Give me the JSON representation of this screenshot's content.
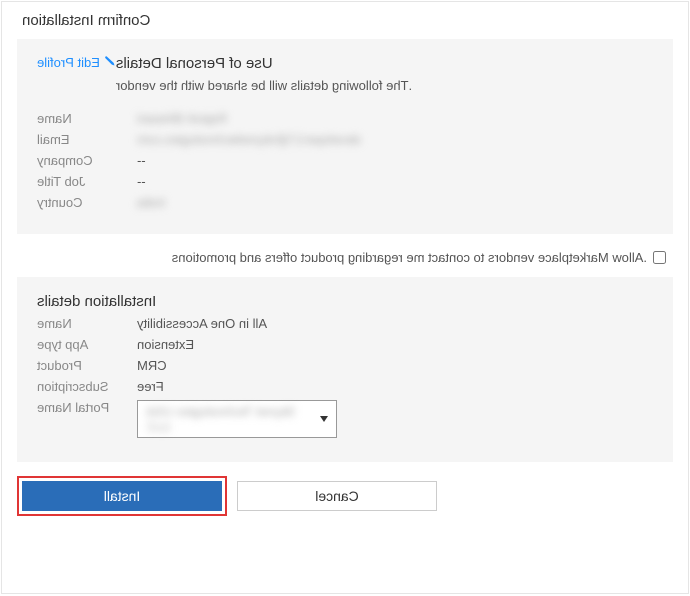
{
  "title": "Confirm Installation",
  "personal": {
    "section_title": "Use of Personal Details",
    "subtitle": "The following details will be shared with the vendor.",
    "edit_label": "Edit Profile",
    "fields": {
      "name_label": "Name",
      "name_value": "Rajesh Bhiwani",
      "email_label": "Email",
      "email_value": "developer17@skynettechnologies.com",
      "company_label": "Company",
      "company_value": "--",
      "jobtitle_label": "Job Title",
      "jobtitle_value": "--",
      "country_label": "Country",
      "country_value": "India"
    }
  },
  "consent": {
    "label": "Allow Marketplace vendors to contact me regarding product offers and promotions."
  },
  "install": {
    "section_title": "Installation details",
    "fields": {
      "name_label": "Name",
      "name_value": "All in One Accessibility",
      "apptype_label": "App type",
      "apptype_value": "Extension",
      "product_label": "Product",
      "product_value": "CRM",
      "subscription_label": "Subscription",
      "subscription_value": "Free",
      "portal_label": "Portal Name",
      "portal_value": "Skynet Technologies USA LLC"
    }
  },
  "buttons": {
    "install": "Install",
    "cancel": "Cancel"
  }
}
